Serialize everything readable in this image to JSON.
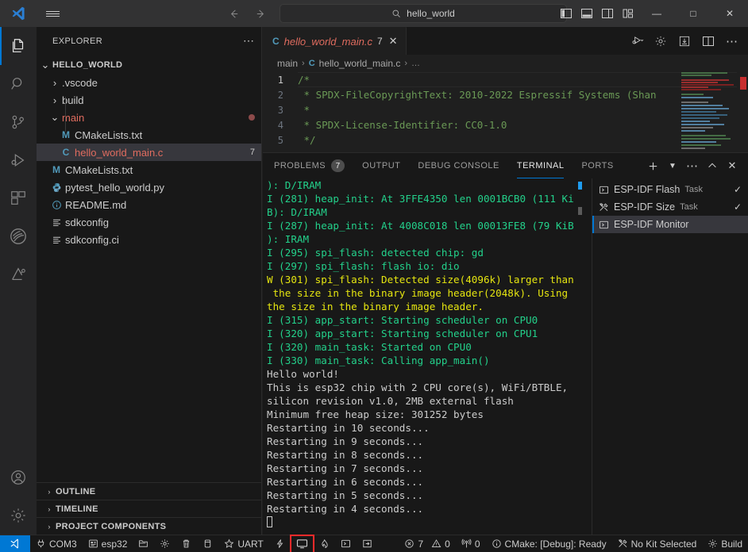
{
  "titlebar": {
    "logo_icon": "vscode-logo-icon",
    "menu_icon": "hamburger-menu-icon",
    "back_icon": "arrow-left-icon",
    "forward_icon": "arrow-right-icon",
    "search": {
      "icon": "search-icon",
      "value": "hello_world",
      "placeholder": "Search"
    },
    "layout_icons": [
      "toggle-primary-sidebar-icon",
      "toggle-panel-icon",
      "toggle-secondary-sidebar-icon",
      "customize-layout-icon"
    ],
    "window_controls": {
      "minimize": "—",
      "maximize": "□",
      "close": "✕"
    }
  },
  "activitybar": {
    "items": [
      {
        "name": "explorer",
        "icon": "files-icon",
        "active": true
      },
      {
        "name": "search",
        "icon": "search-icon",
        "active": false
      },
      {
        "name": "source-control",
        "icon": "source-control-icon",
        "active": false
      },
      {
        "name": "run-and-debug",
        "icon": "run-and-debug-icon",
        "active": false
      },
      {
        "name": "extensions",
        "icon": "extensions-icon",
        "active": false
      },
      {
        "name": "espressif-idf",
        "icon": "espressif-idf-icon",
        "active": false
      },
      {
        "name": "wokwi",
        "icon": "wokwi-icon",
        "active": false
      }
    ],
    "bottom": [
      {
        "name": "accounts",
        "icon": "account-icon"
      },
      {
        "name": "manage",
        "icon": "gear-icon"
      }
    ]
  },
  "sidebar": {
    "title": "EXPLORER",
    "more_icon": "more-actions-icon",
    "tree": [
      {
        "label": "HELLO_WORLD",
        "twisty": "∨",
        "kind": "root",
        "depth": 0
      },
      {
        "label": ".vscode",
        "twisty": "›",
        "kind": "folder",
        "depth": 1
      },
      {
        "label": "build",
        "twisty": "›",
        "kind": "folder",
        "depth": 1
      },
      {
        "label": "main",
        "twisty": "∨",
        "kind": "folder-open-modified",
        "depth": 1,
        "dot": true
      },
      {
        "label": "CMakeLists.txt",
        "icon": "M",
        "icon_class": "c-m",
        "kind": "file",
        "depth": 2
      },
      {
        "label": "hello_world_main.c",
        "icon": "C",
        "icon_class": "c-c",
        "kind": "file-selected",
        "depth": 2,
        "badge": "7",
        "selected": true
      },
      {
        "label": "CMakeLists.txt",
        "icon": "M",
        "icon_class": "c-m",
        "kind": "file",
        "depth": 1
      },
      {
        "label": "pytest_hello_world.py",
        "icon": "py",
        "icon_class": "c-py",
        "kind": "file",
        "depth": 1
      },
      {
        "label": "README.md",
        "icon": "i",
        "icon_class": "c-md",
        "kind": "file",
        "depth": 1
      },
      {
        "label": "sdkconfig",
        "icon": "cfg",
        "icon_class": "c-cfg",
        "kind": "file",
        "depth": 1
      },
      {
        "label": "sdkconfig.ci",
        "icon": "cfg",
        "icon_class": "c-cfg",
        "kind": "file",
        "depth": 1
      }
    ],
    "sections": [
      {
        "label": "OUTLINE",
        "twisty": "›"
      },
      {
        "label": "TIMELINE",
        "twisty": "›"
      },
      {
        "label": "PROJECT COMPONENTS",
        "twisty": "›"
      }
    ]
  },
  "editor": {
    "tab": {
      "icon": "C",
      "name": "hello_world_main.c",
      "error_count": "7",
      "close_icon": "close-icon"
    },
    "actions": [
      "run-or-debug-icon",
      "gear-icon",
      "esp-idf-build-icon",
      "split-editor-icon",
      "more-actions-icon"
    ],
    "breadcrumb": {
      "root": "main",
      "file_icon": "C",
      "file": "hello_world_main.c",
      "tail": "…",
      "sep": "›"
    },
    "lines": [
      {
        "no": "1",
        "text": "/*"
      },
      {
        "no": "2",
        "text": " * SPDX-FileCopyrightText: 2010-2022 Espressif Systems (Shan"
      },
      {
        "no": "3",
        "text": " *"
      },
      {
        "no": "4",
        "text": " * SPDX-License-Identifier: CC0-1.0"
      },
      {
        "no": "5",
        "text": " */"
      }
    ]
  },
  "panel": {
    "tabs": [
      {
        "label": "PROBLEMS",
        "count": "7",
        "active": false
      },
      {
        "label": "OUTPUT",
        "count": null,
        "active": false
      },
      {
        "label": "DEBUG CONSOLE",
        "count": null,
        "active": false
      },
      {
        "label": "TERMINAL",
        "count": null,
        "active": true
      },
      {
        "label": "PORTS",
        "count": null,
        "active": false
      }
    ],
    "actions": [
      "new-terminal-icon",
      "chevron-down-icon",
      "more-actions-icon",
      "chevron-up-icon",
      "close-icon"
    ],
    "terminal_lines": [
      {
        "text": "): D/IRAM",
        "color": "g"
      },
      {
        "text": "I (281) heap_init: At 3FFE4350 len 0001BCB0 (111 Ki",
        "color": "g"
      },
      {
        "text": "B): D/IRAM",
        "color": "g"
      },
      {
        "text": "I (287) heap_init: At 4008C018 len 00013FE8 (79 KiB",
        "color": "g"
      },
      {
        "text": "): IRAM",
        "color": "g"
      },
      {
        "text": "I (295) spi_flash: detected chip: gd",
        "color": "g"
      },
      {
        "text": "I (297) spi_flash: flash io: dio",
        "color": "g"
      },
      {
        "text": "W (301) spi_flash: Detected size(4096k) larger than",
        "color": "y"
      },
      {
        "text": " the size in the binary image header(2048k). Using",
        "color": "y"
      },
      {
        "text": "the size in the binary image header.",
        "color": "y"
      },
      {
        "text": "I (315) app_start: Starting scheduler on CPU0",
        "color": "g"
      },
      {
        "text": "I (320) app_start: Starting scheduler on CPU1",
        "color": "g"
      },
      {
        "text": "I (320) main_task: Started on CPU0",
        "color": "g"
      },
      {
        "text": "I (330) main_task: Calling app_main()",
        "color": "g"
      },
      {
        "text": "Hello world!",
        "color": "w"
      },
      {
        "text": "This is esp32 chip with 2 CPU core(s), WiFi/BTBLE,",
        "color": "w"
      },
      {
        "text": "silicon revision v1.0, 2MB external flash",
        "color": "w"
      },
      {
        "text": "Minimum free heap size: 301252 bytes",
        "color": "w"
      },
      {
        "text": "Restarting in 10 seconds...",
        "color": "w"
      },
      {
        "text": "Restarting in 9 seconds...",
        "color": "w"
      },
      {
        "text": "Restarting in 8 seconds...",
        "color": "w"
      },
      {
        "text": "Restarting in 7 seconds...",
        "color": "w"
      },
      {
        "text": "Restarting in 6 seconds...",
        "color": "w"
      },
      {
        "text": "Restarting in 5 seconds...",
        "color": "w"
      },
      {
        "text": "Restarting in 4 seconds...",
        "color": "w"
      }
    ],
    "tasks": [
      {
        "label": "ESP-IDF Flash",
        "kind": "Task",
        "icon": "terminal-square-icon",
        "check": "✓",
        "selected": false
      },
      {
        "label": "ESP-IDF Size",
        "kind": "Task",
        "icon": "tools-icon",
        "check": "✓",
        "selected": false
      },
      {
        "label": "ESP-IDF Monitor",
        "kind": "",
        "icon": "terminal-square-icon",
        "check": "",
        "selected": true
      }
    ]
  },
  "statusbar": {
    "remote_icon": "remote-window-icon",
    "left": [
      {
        "icon": "plug-icon",
        "label": "COM3",
        "name": "serial-port"
      },
      {
        "icon": "chip-icon",
        "label": "esp32",
        "name": "target-device"
      },
      {
        "icon": "folder-open-icon",
        "label": "",
        "name": "sdk-configuration-editor"
      },
      {
        "icon": "gear-icon",
        "label": "",
        "name": "menuconfig"
      },
      {
        "icon": "trash-icon",
        "label": "",
        "name": "full-clean"
      },
      {
        "icon": "database-icon",
        "label": "",
        "name": "build"
      },
      {
        "icon": "star-icon",
        "label": "UART",
        "name": "flash-method"
      },
      {
        "icon": "zap-icon",
        "label": "",
        "name": "flash-device"
      },
      {
        "icon": "monitor-icon",
        "label": "",
        "name": "monitor-device",
        "boxed": true
      },
      {
        "icon": "flame-icon",
        "label": "",
        "name": "debug"
      },
      {
        "icon": "terminal-square-icon",
        "label": "",
        "name": "open-esp-idf-terminal"
      },
      {
        "icon": "login-icon",
        "label": "",
        "name": "build-flash-monitor"
      }
    ],
    "right": [
      {
        "icon": "error-icon",
        "label": "7",
        "warn_icon": "warning-icon",
        "warn_label": "0",
        "name": "problems-status"
      },
      {
        "icon": "radio-tower-icon",
        "label": "0",
        "name": "ports-status"
      },
      {
        "icon": "info-icon",
        "label": "CMake: [Debug]: Ready",
        "name": "cmake-status"
      },
      {
        "icon": "tools-icon",
        "label": "No Kit Selected",
        "name": "cmake-kit"
      },
      {
        "icon": "gear-icon",
        "label": "Build",
        "name": "cmake-build"
      }
    ]
  }
}
